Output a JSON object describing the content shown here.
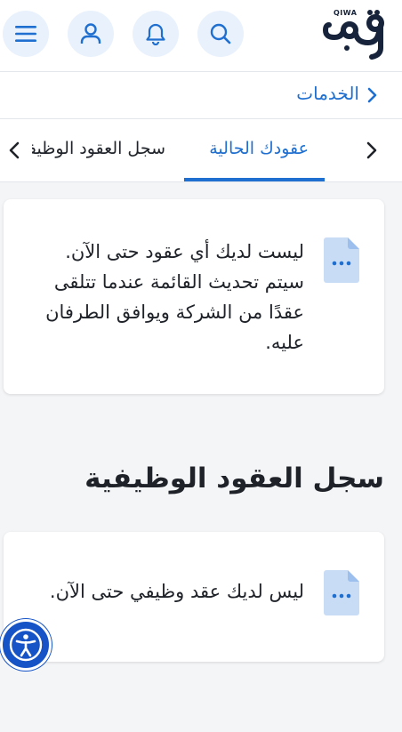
{
  "header": {
    "logo_small_text": "QIWA",
    "logo_text": "قوى",
    "menu_icon": "menu-icon",
    "profile_icon": "user-icon",
    "notifications_icon": "bell-icon",
    "search_icon": "search-icon"
  },
  "breadcrumb": {
    "label": "الخدمات"
  },
  "tabs": [
    {
      "label": "عقودك الحالية",
      "active": true
    },
    {
      "label": "سجل العقود الوظيفية",
      "active": false
    }
  ],
  "current_contracts_card": {
    "message": "ليست لديك أي عقود حتى الآن. سيتم تحديث القائمة عندما تتلقى عقدًا من الشركة ويوافق الطرفان عليه."
  },
  "history_section": {
    "title": "سجل العقود الوظيفية",
    "empty_message": "ليس لديك عقد وظيفي حتى الآن."
  },
  "colors": {
    "accent": "#1f6fd0",
    "icon_bg": "#e9f1fc",
    "doc_icon": "#c9dcf6",
    "a11y": "#1553c7"
  }
}
